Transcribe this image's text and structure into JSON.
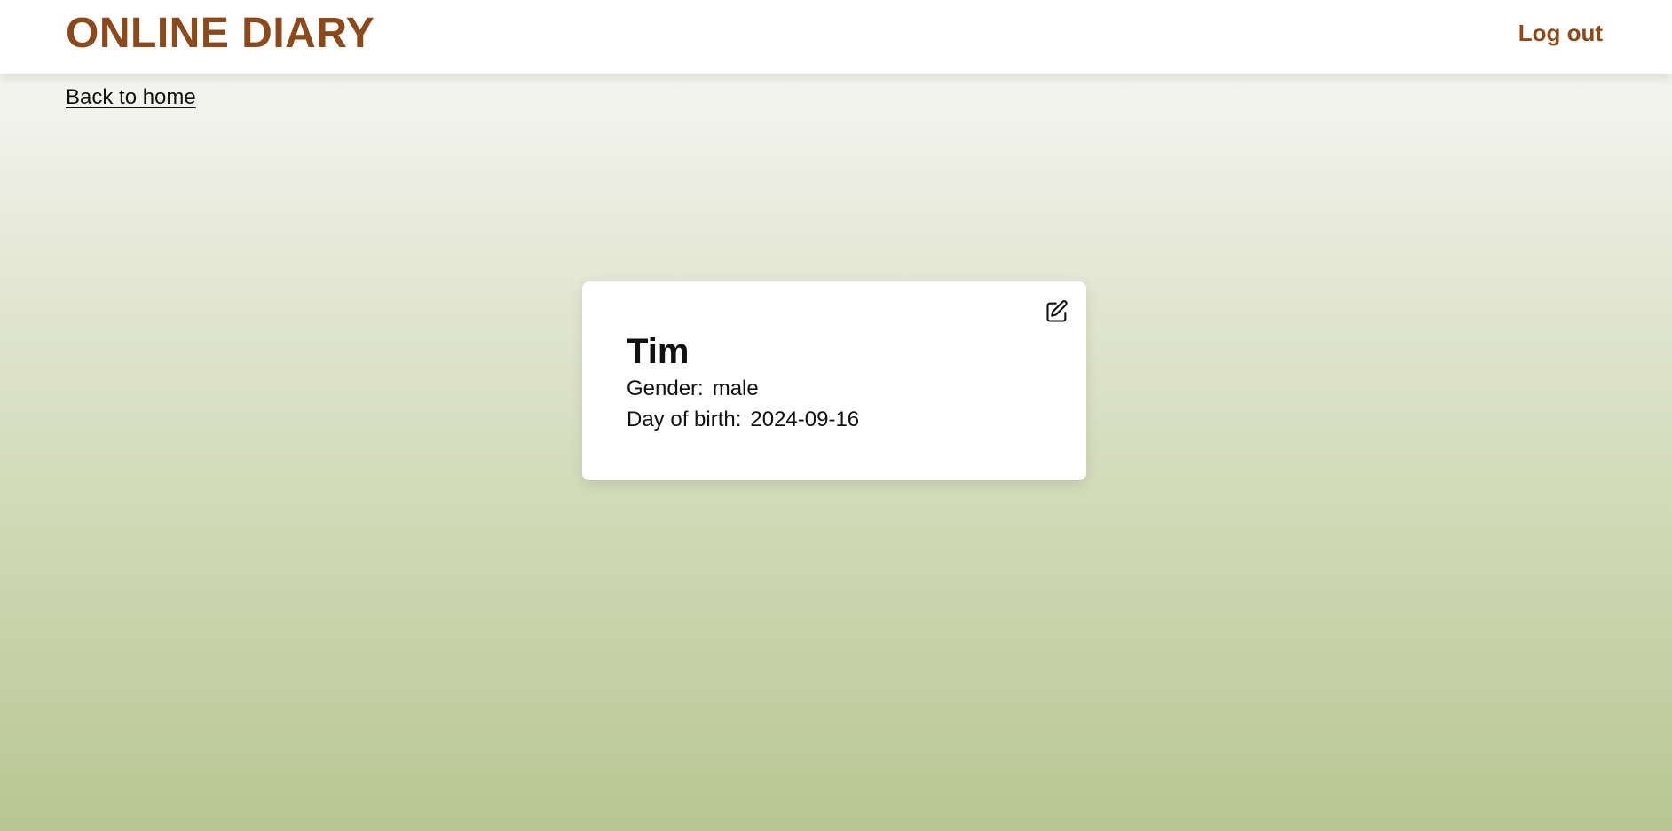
{
  "header": {
    "brand": "ONLINE DIARY",
    "logout_label": "Log out"
  },
  "nav": {
    "back_label": "Back to home"
  },
  "profile": {
    "name": "Tim",
    "gender_label": "Gender:",
    "gender_value": "male",
    "dob_label": "Day of birth:",
    "dob_value": "2024-09-16",
    "edit_icon": "pencil-square-icon"
  },
  "colors": {
    "brand": "#8b4a1c",
    "card_background": "#ffffff",
    "page_gradient_top": "#f6f6f2",
    "page_gradient_bottom": "#b8c693",
    "text": "#111111"
  }
}
